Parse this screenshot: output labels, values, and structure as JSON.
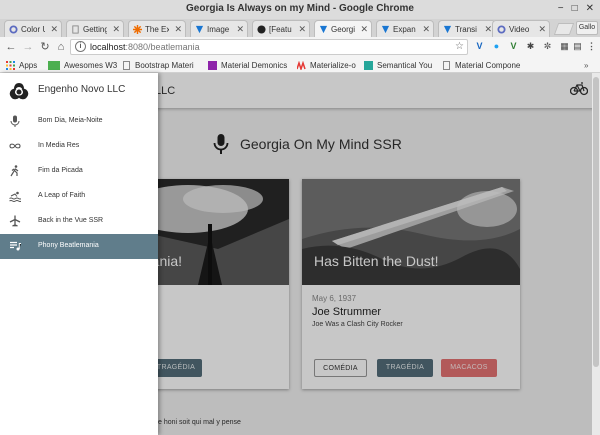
{
  "window": {
    "title": "Georgia Is Always on my Mind - Google Chrome"
  },
  "tabs": [
    {
      "label": "Color U",
      "icon": "gear-icon",
      "color": "#5c6bc0"
    },
    {
      "label": "Getting",
      "icon": "page-icon",
      "color": "#888888"
    },
    {
      "label": "The Ex",
      "icon": "asterisk-icon",
      "color": "#ef6c00"
    },
    {
      "label": "Image",
      "icon": "vuetify-icon",
      "color": "#1976d2"
    },
    {
      "label": "[Featu",
      "icon": "github-icon",
      "color": "#222222"
    },
    {
      "label": "Georgi",
      "icon": "vuetify-icon",
      "color": "#1976d2"
    },
    {
      "label": "Expan",
      "icon": "vuetify-icon",
      "color": "#1976d2"
    },
    {
      "label": "Transi",
      "icon": "vuetify-icon",
      "color": "#1976d2"
    },
    {
      "label": "Video",
      "icon": "gear-icon",
      "color": "#5c6bc0"
    }
  ],
  "profile_label": "Gallo",
  "address": {
    "host": "localhost",
    "path": ":8080/beatlemania"
  },
  "bookmarks": [
    {
      "label": "Apps",
      "icon": "apps-grid-icon",
      "color": "#e53935"
    },
    {
      "label": "Awesomes W3",
      "icon": "w3-icon",
      "color": "#4caf50"
    },
    {
      "label": "Bootstrap Materi",
      "icon": "page-icon",
      "color": "#888888"
    },
    {
      "label": "Material Demonics",
      "icon": "demonics-icon",
      "color": "#8e24aa"
    },
    {
      "label": "Materialize-o",
      "icon": "materialize-icon",
      "color": "#e53935"
    },
    {
      "label": "Semantical You",
      "icon": "s-icon",
      "color": "#26a69a"
    },
    {
      "label": "Material Compone",
      "icon": "page-icon",
      "color": "#888888"
    }
  ],
  "appbar": {
    "title": "LLC"
  },
  "drawer": {
    "title": "Engenho Novo LLC",
    "items": [
      {
        "label": "Bom Dia, Meia-Noite",
        "icon": "mic-icon",
        "active": false
      },
      {
        "label": "In Media Res",
        "icon": "infinity-icon",
        "active": false
      },
      {
        "label": "Fim da Picada",
        "icon": "walk-icon",
        "active": false
      },
      {
        "label": "A Leap of Faith",
        "icon": "pool-icon",
        "active": false
      },
      {
        "label": "Back in the Vue SSR",
        "icon": "airplane-icon",
        "active": false
      },
      {
        "label": "Phony Beatlemania",
        "icon": "playlist-icon",
        "active": true
      }
    ]
  },
  "main": {
    "heading": "Georgia On My Mind SSR",
    "cards": [
      {
        "caption": "mania!",
        "buttons": [
          {
            "label": "TRAGÉDIA",
            "style": "dark"
          }
        ]
      },
      {
        "caption": "Has Bitten the Dust!",
        "date": "May 6, 1937",
        "name": "Joe Strummer",
        "subtitle": "Joe Was a Clash City Rocker",
        "buttons": [
          {
            "label": "COMÉDIA",
            "style": "flat"
          },
          {
            "label": "TRAGÉDIA",
            "style": "dark"
          },
          {
            "label": "MACACOS",
            "style": "red"
          }
        ]
      }
    ],
    "footer_text": "e honi soit qui mal y pense"
  }
}
